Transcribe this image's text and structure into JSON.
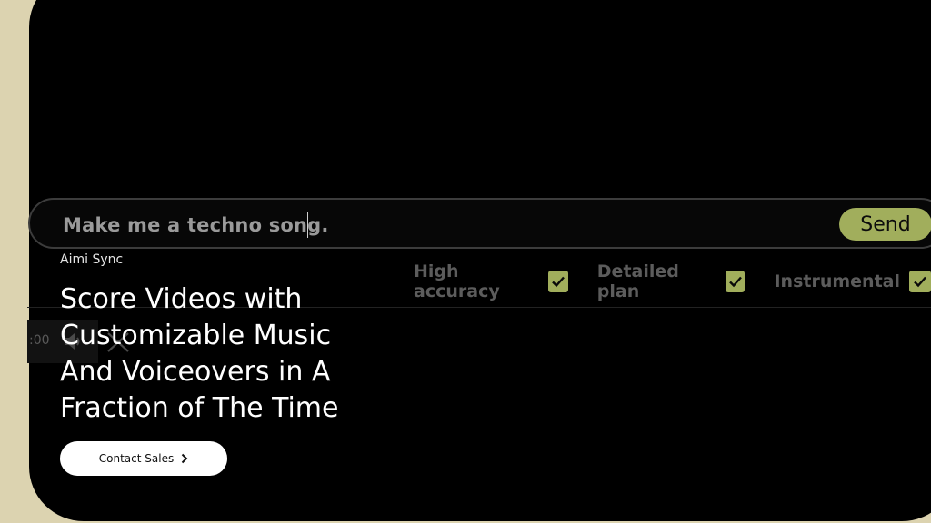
{
  "prompt": {
    "value": "Make me a techno song.",
    "send_label": "Send"
  },
  "options": [
    {
      "label": "High accuracy",
      "checked": true
    },
    {
      "label": "Detailed plan",
      "checked": true
    },
    {
      "label": "Instrumental",
      "checked": true
    }
  ],
  "player": {
    "time": ":00"
  },
  "hero": {
    "brand": "Aimi Sync",
    "headline": "Score Videos with Customizable Music And Voiceovers in A Fraction of The Time",
    "cta_label": "Contact Sales"
  },
  "colors": {
    "background": "#dcd3b0",
    "card": "#000000",
    "accent": "#a1ae5c"
  }
}
